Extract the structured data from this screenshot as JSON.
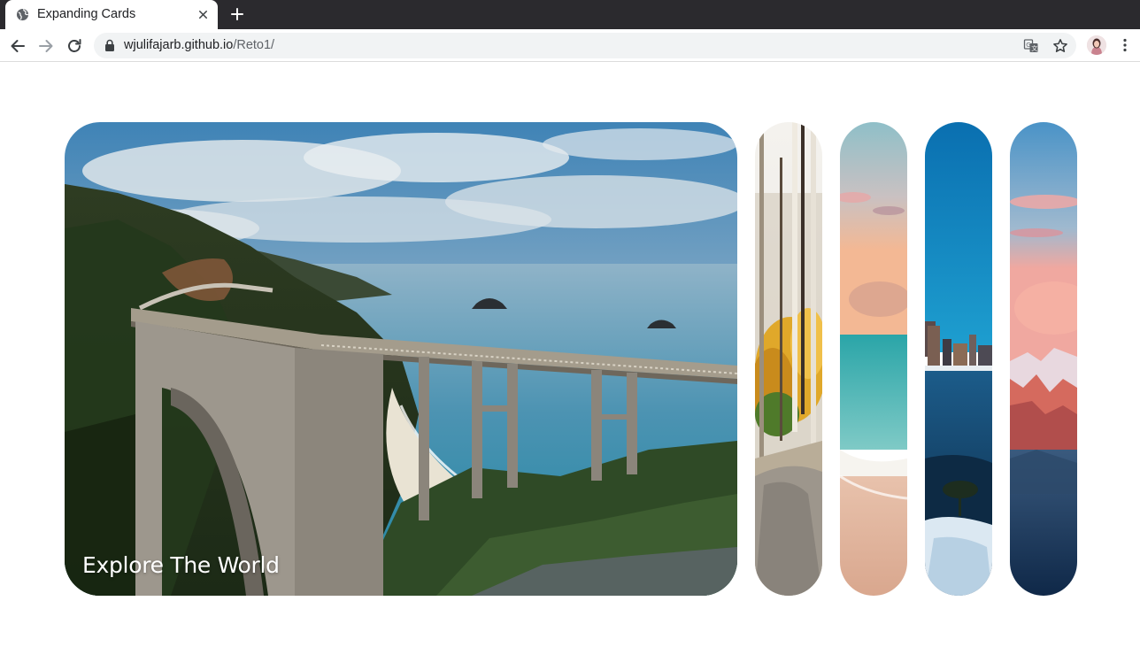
{
  "browser": {
    "tab_title": "Expanding Cards",
    "url_host": "wjulifajarb.github.io",
    "url_path": "/Reto1/"
  },
  "cards": [
    {
      "title": "Explore The World",
      "active": true,
      "scene": "coastal-bridge"
    },
    {
      "title": "",
      "active": false,
      "scene": "autumn-forest"
    },
    {
      "title": "",
      "active": false,
      "scene": "beach-sunset"
    },
    {
      "title": "",
      "active": false,
      "scene": "winter-city"
    },
    {
      "title": "",
      "active": false,
      "scene": "pink-mountains"
    }
  ]
}
